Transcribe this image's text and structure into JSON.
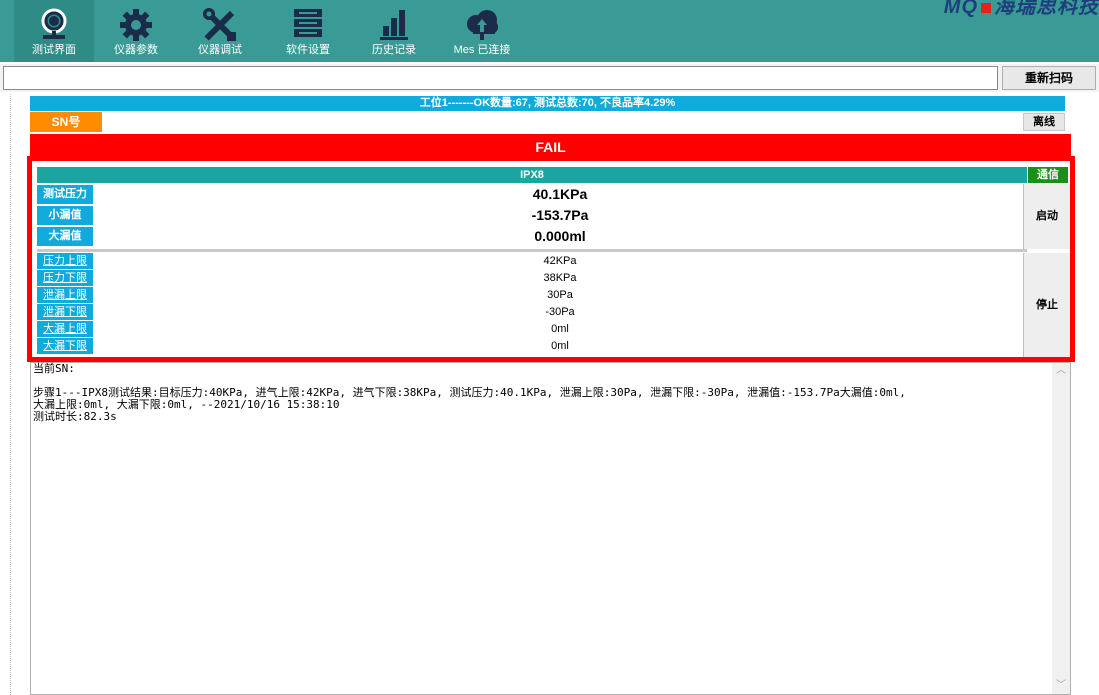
{
  "toolbar": {
    "items": [
      {
        "label": "测试界面",
        "icon": "webcam-icon"
      },
      {
        "label": "仪器参数",
        "icon": "gear-icon"
      },
      {
        "label": "仪器调试",
        "icon": "tools-icon"
      },
      {
        "label": "软件设置",
        "icon": "server-icon"
      },
      {
        "label": "历史记录",
        "icon": "bar-chart-icon"
      },
      {
        "label": "Mes 已连接",
        "icon": "cloud-upload-icon"
      }
    ],
    "brand": "海瑞思科技"
  },
  "scan": {
    "value": "",
    "rescan_label": "重新扫码"
  },
  "station": {
    "summary": "工位1-------OK数量:67, 测试总数:70, 不良品率4.29%"
  },
  "sn": {
    "label": "SN号",
    "value": "",
    "offline_label": "离线"
  },
  "result": {
    "status": "FAIL"
  },
  "panel": {
    "title": "IPX8",
    "comm_label": "通信",
    "start_label": "启动",
    "stop_label": "停止",
    "measurements": [
      {
        "label": "测试压力",
        "value": "40.1KPa"
      },
      {
        "label": "小漏值",
        "value": "-153.7Pa"
      },
      {
        "label": "大漏值",
        "value": "0.000ml"
      }
    ],
    "limits": [
      {
        "label": "压力上限",
        "value": "42KPa"
      },
      {
        "label": "压力下限",
        "value": "38KPa"
      },
      {
        "label": "泄漏上限",
        "value": "30Pa"
      },
      {
        "label": "泄漏下限",
        "value": "-30Pa"
      },
      {
        "label": "大漏上限",
        "value": "0ml"
      },
      {
        "label": "大漏下限",
        "value": "0ml"
      }
    ]
  },
  "log": {
    "text": "当前SN:\n\n步骤1---IPX8测试结果:目标压力:40KPa, 进气上限:42KPa, 进气下限:38KPa, 测试压力:40.1KPa, 泄漏上限:30Pa, 泄漏下限:-30Pa, 泄漏值:-153.7Pa大漏值:0ml,\n大漏上限:0ml, 大漏下限:0ml, --2021/10/16 15:38:10\n测试时长:82.3s"
  },
  "colors": {
    "toolbar_bg": "#3a9a95",
    "fail_red": "#ff0000",
    "label_blue": "#10aadd",
    "sn_orange": "#ff8c00",
    "comm_green": "#1a8f1a"
  }
}
